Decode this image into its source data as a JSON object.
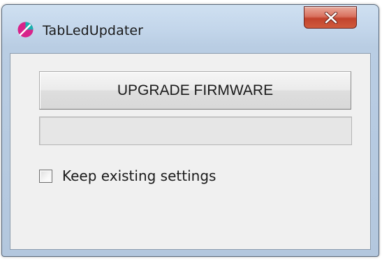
{
  "window": {
    "title": "TabLedUpdater",
    "app_icon": "tabled-app-icon",
    "close_icon": "close-x-icon"
  },
  "main": {
    "upgrade_button_label": "UPGRADE FIRMWARE",
    "progress": 0,
    "keep_settings_label": "Keep existing settings",
    "keep_settings_checked": false
  },
  "colors": {
    "close_button": "#c2432d",
    "icon_magenta": "#d8238a",
    "icon_teal": "#17b3b0",
    "client_background": "#f0f0f0"
  }
}
